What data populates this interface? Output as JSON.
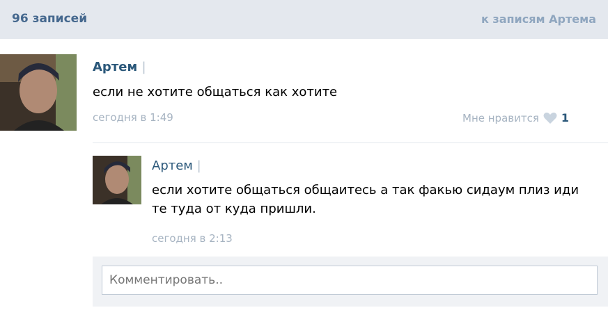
{
  "header": {
    "count_label": "96 записей",
    "back_link": "к записям Артема"
  },
  "post": {
    "author": "Артем",
    "text": "если не хотите общаться как хотите",
    "time": "сегодня в 1:49",
    "like_label": "Мне нравится",
    "like_count": "1"
  },
  "reply": {
    "author": "Артем",
    "text": "если хотите общаться общаитесь а так факью сидаум плиз иди те туда от куда пришли.",
    "time": "сегодня в 2:13"
  },
  "comment": {
    "placeholder": "Комментировать.."
  },
  "colors": {
    "link": "#2b587a",
    "header_bg": "#e4e8ee",
    "muted": "#a7b4c2"
  }
}
